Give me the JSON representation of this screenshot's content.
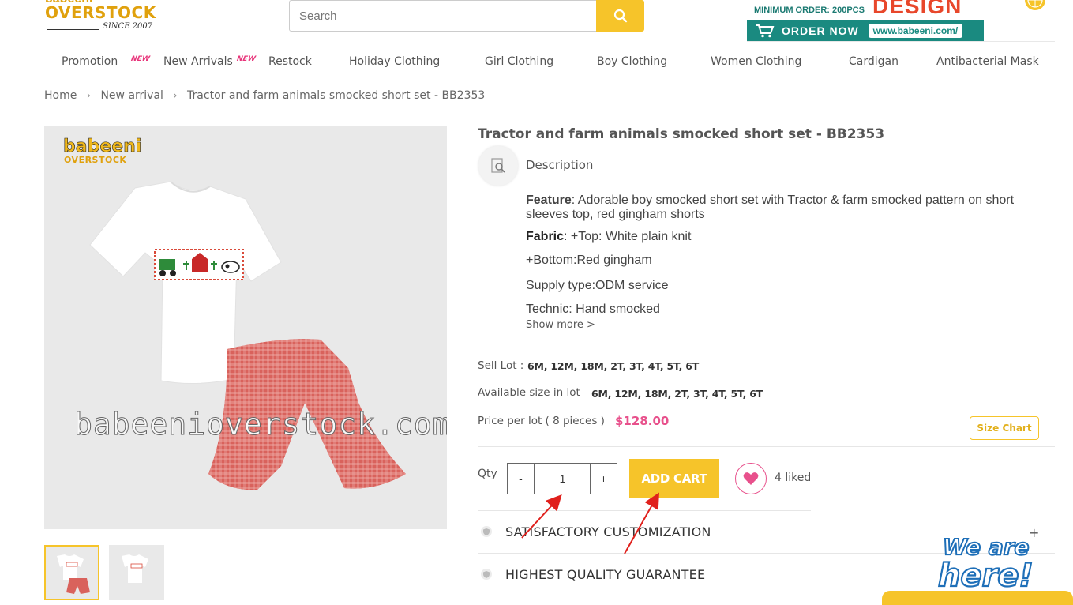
{
  "header": {
    "logo_top": "babeeni",
    "logo_word": "OVERSTOCK",
    "logo_since": "SINCE 2007",
    "search_placeholder": "Search",
    "promo_min_order": "MINIMUM ORDER: 200PCS",
    "promo_design": "DESIGN",
    "promo_order_now": "ORDER NOW",
    "promo_url": "www.babeeni.com/"
  },
  "nav": {
    "items": [
      {
        "label": "Promotion"
      },
      {
        "label": "New Arrivals"
      },
      {
        "label": "Restock"
      },
      {
        "label": "Holiday Clothing"
      },
      {
        "label": "Girl Clothing"
      },
      {
        "label": "Boy Clothing"
      },
      {
        "label": "Women Clothing"
      },
      {
        "label": "Cardigan"
      },
      {
        "label": "Antibacterial Mask"
      }
    ],
    "new_badge": "NEW"
  },
  "breadcrumb": {
    "home": "Home",
    "section": "New arrival",
    "current": "Tractor and farm animals smocked short set - BB2353"
  },
  "product": {
    "title": "Tractor and farm animals smocked short set - BB2353",
    "image_logo_word": "babeeni",
    "image_logo_sub": "OVERSTOCK",
    "image_watermark": "babeenioverstock.com",
    "description_label": "Description",
    "feature_label": "Feature",
    "feature_text": ": Adorable boy smocked short set with Tractor & farm smocked pattern on short sleeves top, red gingham shorts",
    "fabric_label": "Fabric",
    "fabric_text": ": +Top: White plain knit",
    "bottom_text": "+Bottom:Red gingham",
    "supply_text": "Supply type:ODM service",
    "technic_text": "Technic: Hand smocked",
    "show_more": "Show more >",
    "sell_lot_label": "Sell Lot :",
    "sell_lot_value": "6M, 12M, 18M, 2T, 3T, 4T, 5T, 6T",
    "available_label": "Available size in lot",
    "available_value": "6M, 12M, 18M, 2T, 3T, 4T, 5T, 6T",
    "price_label": "Price per lot ( 8 pieces )",
    "price_value": "$128.00",
    "size_chart": "Size Chart",
    "qty_label": "Qty",
    "qty_value": "1",
    "qty_minus": "-",
    "qty_plus": "+",
    "add_cart": "ADD CART",
    "liked": "4 liked",
    "guarantee_1": "SATISFACTORY CUSTOMIZATION",
    "guarantee_2": "HIGHEST QUALITY GUARANTEE",
    "expand_symbol": "+"
  },
  "chat_widget": {
    "line1": "We are",
    "line2": "here!"
  },
  "colors": {
    "accent_yellow": "#f6c42a",
    "price_pink": "#e8518c",
    "brand_teal": "#1a8a80",
    "annotation_red": "#e0201c"
  }
}
